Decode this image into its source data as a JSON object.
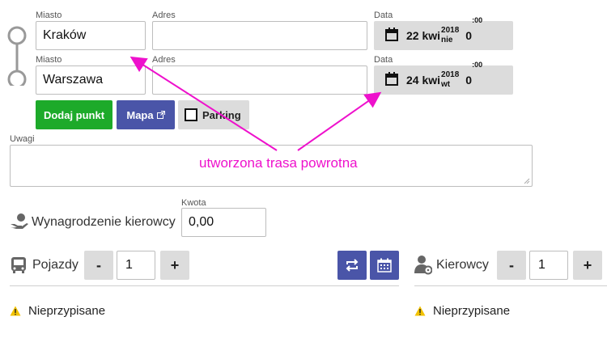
{
  "route": {
    "points": [
      {
        "city_label": "Miasto",
        "city_value": "Kraków",
        "address_label": "Adres",
        "address_value": "",
        "date_label": "Data",
        "date_day": "22 kwi",
        "date_year": "2018",
        "date_dow": "nie",
        "time_hour": "0",
        "time_min": ":00"
      },
      {
        "city_label": "Miasto",
        "city_value": "Warszawa",
        "address_label": "Adres",
        "address_value": "",
        "date_label": "Data",
        "date_day": "24 kwi",
        "date_year": "2018",
        "date_dow": "wt",
        "time_hour": "0",
        "time_min": ":00"
      }
    ],
    "add_point_label": "Dodaj punkt",
    "map_label": "Mapa",
    "parking_label": "Parking"
  },
  "notes": {
    "label": "Uwagi",
    "value": ""
  },
  "annotation": {
    "text": "utworzona trasa powrotna",
    "color": "#ee11cc"
  },
  "driver_pay": {
    "label": "Wynagrodzenie kierowcy",
    "amount_label": "Kwota",
    "amount_value": "0,00"
  },
  "vehicles": {
    "label": "Pojazdy",
    "minus": "-",
    "count": "1",
    "plus": "+",
    "status": "Nieprzypisane"
  },
  "drivers": {
    "label": "Kierowcy",
    "minus": "-",
    "count": "1",
    "plus": "+",
    "status": "Nieprzypisane"
  },
  "colors": {
    "green": "#1daa2a",
    "blue": "#4a55a8",
    "grey": "#dcdcdc",
    "warning": "#f2c200"
  }
}
